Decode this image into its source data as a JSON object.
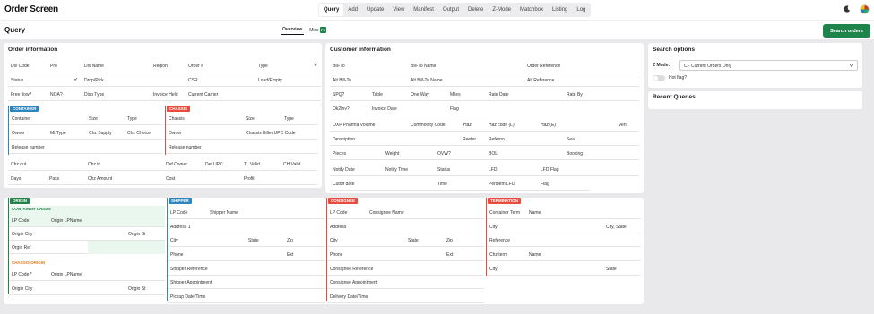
{
  "header": {
    "app_title": "Order Screen",
    "nav": [
      "Query",
      "Add",
      "Update",
      "View",
      "Manifest",
      "Output",
      "Delete",
      "Z-Mode",
      "Matchbox",
      "Listing",
      "Log"
    ],
    "active_nav": "Query"
  },
  "subheader": {
    "page_title": "Query",
    "tab_overview": "Overview",
    "tab_misc": "Misc",
    "misc_badge": "F4",
    "search_button": "Search orders"
  },
  "order_info": {
    "title": "Order information",
    "row1": [
      "Div Code",
      "Pro",
      "Div Name",
      "Region",
      "Order #",
      "Type"
    ],
    "row2": [
      "Status",
      "Drop/Pick",
      "CSR",
      "Load/Empty"
    ],
    "row3": [
      "Free flow?",
      "NOA?",
      "Disp Type",
      "Invoice Held",
      "Current Carrier"
    ]
  },
  "container": {
    "tag": "CONTAINER",
    "row1": [
      "Container",
      "Size",
      "Type"
    ],
    "row2": [
      "Owner",
      "Mt Type",
      "Chz Supply",
      "Chz Choice"
    ],
    "row3": [
      "Release number"
    ]
  },
  "chassis": {
    "tag": "CHASSIS",
    "row1": [
      "Chassis",
      "Size",
      "Type"
    ],
    "row2": [
      "Owner",
      "Chassis Biller UPC Code"
    ],
    "row3": [
      "Release number"
    ]
  },
  "chz_rows": {
    "row1": [
      "Chz out",
      "Chz in",
      "Def Owner",
      "Def UPC",
      "TL Valid",
      "CH Valid"
    ],
    "row2": [
      "Days",
      "Pass",
      "Chz Amount",
      "Cost",
      "Profit"
    ]
  },
  "customer_info": {
    "title": "Customer information",
    "row1": [
      "Bill-To",
      "Bill-To Name",
      "Order Reference"
    ],
    "row2": [
      "Alt Bill-To",
      "Alt Bill-To Name",
      "Alt Reference"
    ],
    "row3": [
      "SPQ?",
      "Table",
      "One Way",
      "Miles",
      "Rate Date",
      "Rate By"
    ],
    "row4": [
      "Ok2Inv?",
      "Invoice Date",
      "Flag"
    ],
    "row5": [
      "OXP Pharma Volume",
      "Commodity Code",
      "Haz",
      "Haz code (L)",
      "Haz (E)",
      "Vent"
    ],
    "row6": [
      "Description",
      "Reefer",
      "Referno",
      "Seal"
    ],
    "row7": [
      "Pieces",
      "Weight",
      "OVW?",
      "BOL",
      "Booking"
    ],
    "row8": [
      "Notify Date",
      "Notify Time",
      "Status",
      "LFD",
      "LFD Flag"
    ],
    "row9": [
      "Cutoff date",
      "Time",
      "Perdiem LFD",
      "Flag"
    ]
  },
  "search_options": {
    "title": "Search options",
    "zmode_label": "Z Mode:",
    "zmode_value": "C - Current Orders Only",
    "hot_flag_label": "Hot flag?"
  },
  "recent_queries": {
    "title": "Recent Queries"
  },
  "origin": {
    "tag": "ORIGIN",
    "container_origin_tag": "CONTAINER ORIGIN",
    "co_row1": [
      "LP Code",
      "Origin LPName"
    ],
    "co_row2": [
      "Origin City",
      "Origin St"
    ],
    "co_row3": [
      "Orgin Ref"
    ],
    "chassis_origin_tag": "CHASSIS ORIGIN",
    "cho_row1": [
      "LP Code *",
      "Origin LPName"
    ],
    "cho_row2": [
      "Origin City",
      "Origin St"
    ]
  },
  "shipper": {
    "tag": "SHIPPER",
    "rows": [
      [
        "LP Code",
        "Shipper Name"
      ],
      [
        "Address 1"
      ],
      [
        "City",
        "State",
        "Zip"
      ],
      [
        "Phone",
        "Ext"
      ],
      [
        "Shipper Reference"
      ],
      [
        "Shipper Appointment"
      ],
      [
        "Pickup Date/Time"
      ]
    ]
  },
  "consignee": {
    "tag": "CONSIGNEE",
    "rows": [
      [
        "LP Code",
        "Consignee Name"
      ],
      [
        "Address"
      ],
      [
        "City",
        "State",
        "Zip"
      ],
      [
        "Phone",
        "Ext"
      ],
      [
        "Consignee Reference"
      ],
      [
        "Consignee Appointment"
      ],
      [
        "Delivery Date/Time"
      ]
    ]
  },
  "termination": {
    "tag": "TERMINATION",
    "rows": [
      [
        "Container Term",
        "Name"
      ],
      [
        "City",
        "City, State"
      ],
      [
        "Reference"
      ],
      [
        "Chz term",
        "Name"
      ],
      [
        "City",
        "State"
      ]
    ]
  },
  "colors": {
    "green": "#1e8449",
    "blue": "#2e86c1",
    "red": "#e74c3c",
    "orange": "#e67e22",
    "origin_green": "#1e8449"
  }
}
